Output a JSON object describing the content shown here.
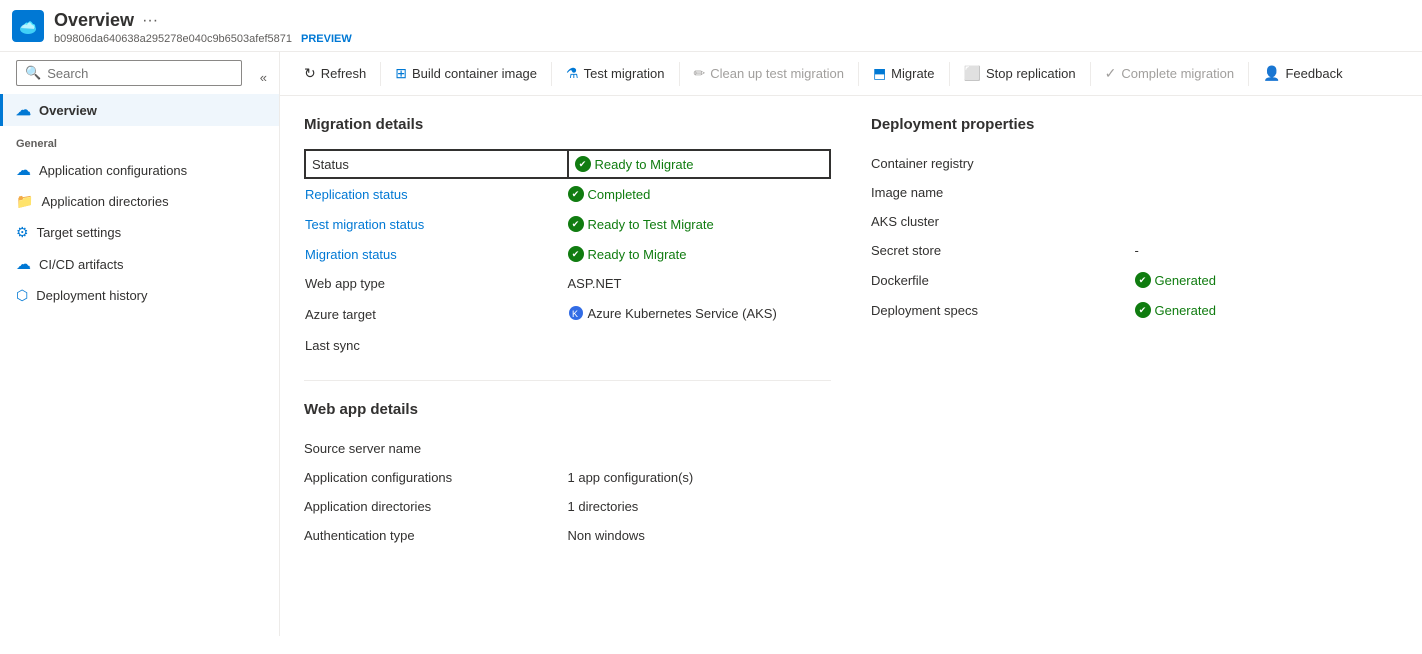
{
  "header": {
    "title": "Overview",
    "ellipsis": "···",
    "subtitle": "b09806da640638a295278e040c9b6503afef5871",
    "preview_label": "PREVIEW"
  },
  "search": {
    "placeholder": "Search"
  },
  "sidebar_collapse": "«",
  "nav": {
    "general_label": "General",
    "items": [
      {
        "id": "overview",
        "label": "Overview",
        "icon": "cloud",
        "active": true
      },
      {
        "id": "app-config",
        "label": "Application configurations",
        "icon": "cloud-blue",
        "active": false
      },
      {
        "id": "app-dir",
        "label": "Application directories",
        "icon": "folder-orange",
        "active": false
      },
      {
        "id": "target-settings",
        "label": "Target settings",
        "icon": "gear-blue",
        "active": false
      },
      {
        "id": "cicd",
        "label": "CI/CD artifacts",
        "icon": "cloud-blue",
        "active": false
      },
      {
        "id": "deploy-history",
        "label": "Deployment history",
        "icon": "cube-blue",
        "active": false
      }
    ]
  },
  "toolbar": {
    "buttons": [
      {
        "id": "refresh",
        "label": "Refresh",
        "icon": "refresh",
        "disabled": false
      },
      {
        "id": "build-container",
        "label": "Build container image",
        "icon": "build",
        "disabled": false
      },
      {
        "id": "test-migration",
        "label": "Test migration",
        "icon": "flask",
        "disabled": false
      },
      {
        "id": "clean-up",
        "label": "Clean up test migration",
        "icon": "eraser",
        "disabled": true
      },
      {
        "id": "migrate",
        "label": "Migrate",
        "icon": "migrate",
        "disabled": false
      },
      {
        "id": "stop-replication",
        "label": "Stop replication",
        "icon": "stop",
        "disabled": false
      },
      {
        "id": "complete-migration",
        "label": "Complete migration",
        "icon": "check",
        "disabled": true
      },
      {
        "id": "feedback",
        "label": "Feedback",
        "icon": "feedback",
        "disabled": false
      }
    ]
  },
  "migration_details": {
    "section_title": "Migration details",
    "rows": [
      {
        "id": "status",
        "label": "Status",
        "value": "Ready to Migrate",
        "type": "status-green",
        "highlighted": true
      },
      {
        "id": "replication-status",
        "label": "Replication status",
        "value": "Completed",
        "type": "badge-green",
        "link": true
      },
      {
        "id": "test-migration-status",
        "label": "Test migration status",
        "value": "Ready to Test Migrate",
        "type": "badge-green",
        "link": true
      },
      {
        "id": "migration-status",
        "label": "Migration status",
        "value": "Ready to Migrate",
        "type": "badge-green",
        "link": true
      },
      {
        "id": "web-app-type",
        "label": "Web app type",
        "value": "ASP.NET",
        "type": "text"
      },
      {
        "id": "azure-target",
        "label": "Azure target",
        "value": "Azure Kubernetes Service (AKS)",
        "type": "aks"
      },
      {
        "id": "last-sync",
        "label": "Last sync",
        "value": "",
        "type": "text"
      }
    ]
  },
  "deployment_properties": {
    "section_title": "Deployment properties",
    "rows": [
      {
        "id": "container-registry",
        "label": "Container registry",
        "value": "",
        "type": "text"
      },
      {
        "id": "image-name",
        "label": "Image name",
        "value": "",
        "type": "text"
      },
      {
        "id": "aks-cluster",
        "label": "AKS cluster",
        "value": "",
        "type": "text"
      },
      {
        "id": "secret-store",
        "label": "Secret store",
        "value": "-",
        "type": "text"
      },
      {
        "id": "dockerfile",
        "label": "Dockerfile",
        "value": "Generated",
        "type": "badge-green"
      },
      {
        "id": "deployment-specs",
        "label": "Deployment specs",
        "value": "Generated",
        "type": "badge-green"
      }
    ]
  },
  "web_app_details": {
    "section_title": "Web app details",
    "rows": [
      {
        "id": "source-server",
        "label": "Source server name",
        "value": "",
        "type": "text"
      },
      {
        "id": "app-configurations",
        "label": "Application configurations",
        "value": "1 app configuration(s)",
        "type": "text"
      },
      {
        "id": "app-directories",
        "label": "Application directories",
        "value": "1 directories",
        "type": "text"
      },
      {
        "id": "auth-type",
        "label": "Authentication type",
        "value": "Non windows",
        "type": "text"
      }
    ]
  }
}
